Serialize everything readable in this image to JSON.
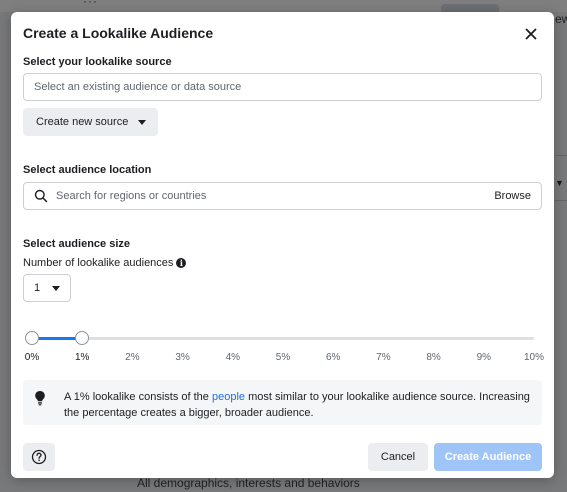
{
  "modal": {
    "title": "Create a Lookalike Audience"
  },
  "source": {
    "label": "Select your lookalike source",
    "placeholder": "Select an existing audience or data source",
    "create_new_label": "Create new source"
  },
  "location": {
    "label": "Select audience location",
    "placeholder": "Search for regions or countries",
    "browse_label": "Browse"
  },
  "size": {
    "label": "Select audience size",
    "count_label": "Number of lookalike audiences",
    "count_value": "1",
    "slider_min_percent": 0,
    "slider_max_percent": 1,
    "ticks": [
      "0%",
      "1%",
      "2%",
      "3%",
      "4%",
      "5%",
      "6%",
      "7%",
      "8%",
      "9%",
      "10%"
    ]
  },
  "note": {
    "prefix": "A 1% lookalike consists of the ",
    "link": "people",
    "suffix": " most similar to your lookalike audience source. Increasing the percentage creates a bigger, broader audience."
  },
  "footer": {
    "cancel_label": "Cancel",
    "create_label": "Create Audience"
  },
  "background": {
    "partial_text_right": "ew",
    "bottom_text": "All demographics, interests and behaviors"
  },
  "colors": {
    "accent": "#1877f2",
    "create_disabled": "#9fc5f8",
    "link": "#216fdb"
  }
}
